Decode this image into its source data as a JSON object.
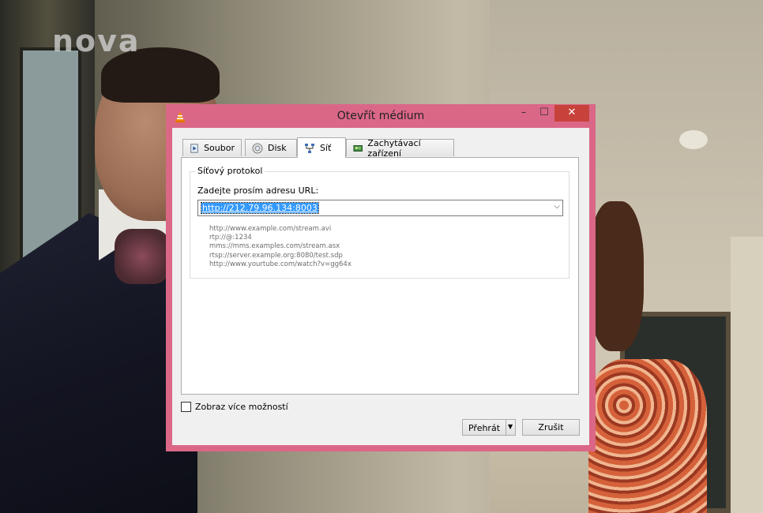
{
  "background": {
    "logo_text": "nova"
  },
  "dialog": {
    "title": "Otevřít médium",
    "icon": "vlc-cone-icon",
    "window_controls": {
      "minimize": "–",
      "maximize": "☐",
      "close": "✕"
    },
    "tabs": [
      {
        "label": "Soubor",
        "icon": "file-play-icon"
      },
      {
        "label": "Disk",
        "icon": "disc-icon"
      },
      {
        "label": "Síť",
        "icon": "network-icon",
        "active": true
      },
      {
        "label": "Zachytávací zařízení",
        "icon": "capture-card-icon"
      }
    ],
    "network": {
      "group_title": "Síťový protokol",
      "url_label": "Zadejte prosím adresu URL:",
      "url_value": "http://212.79.96.134:8003",
      "examples": [
        "http://www.example.com/stream.avi",
        "rtp://@:1234",
        "mms://mms.examples.com/stream.asx",
        "rtsp://server.example.org:8080/test.sdp",
        "http://www.yourtube.com/watch?v=gg64x"
      ]
    },
    "more_options_label": "Zobraz více možností",
    "more_options_checked": false,
    "play_label": "Přehrát",
    "cancel_label": "Zrušit"
  },
  "colors": {
    "titlebar": "#db6787",
    "close_button": "#c7423a",
    "selection": "#3399ff"
  }
}
